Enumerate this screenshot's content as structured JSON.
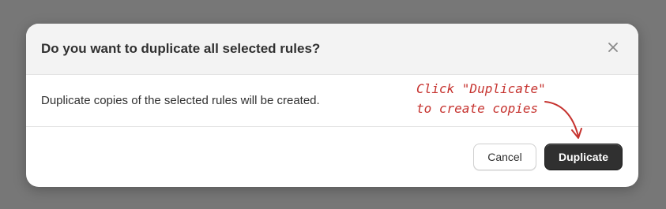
{
  "dialog": {
    "title": "Do you want to duplicate all selected rules?",
    "message": "Duplicate copies of the selected rules will be created.",
    "cancel_label": "Cancel",
    "confirm_label": "Duplicate",
    "close_icon": "close-icon"
  },
  "annotation": {
    "line1": "Click \"Duplicate\"",
    "line2": "to create copies",
    "color": "#c6332f"
  },
  "colors": {
    "backdrop": "#777777",
    "primary_button": "#303030",
    "header_bg": "#f3f3f3"
  }
}
